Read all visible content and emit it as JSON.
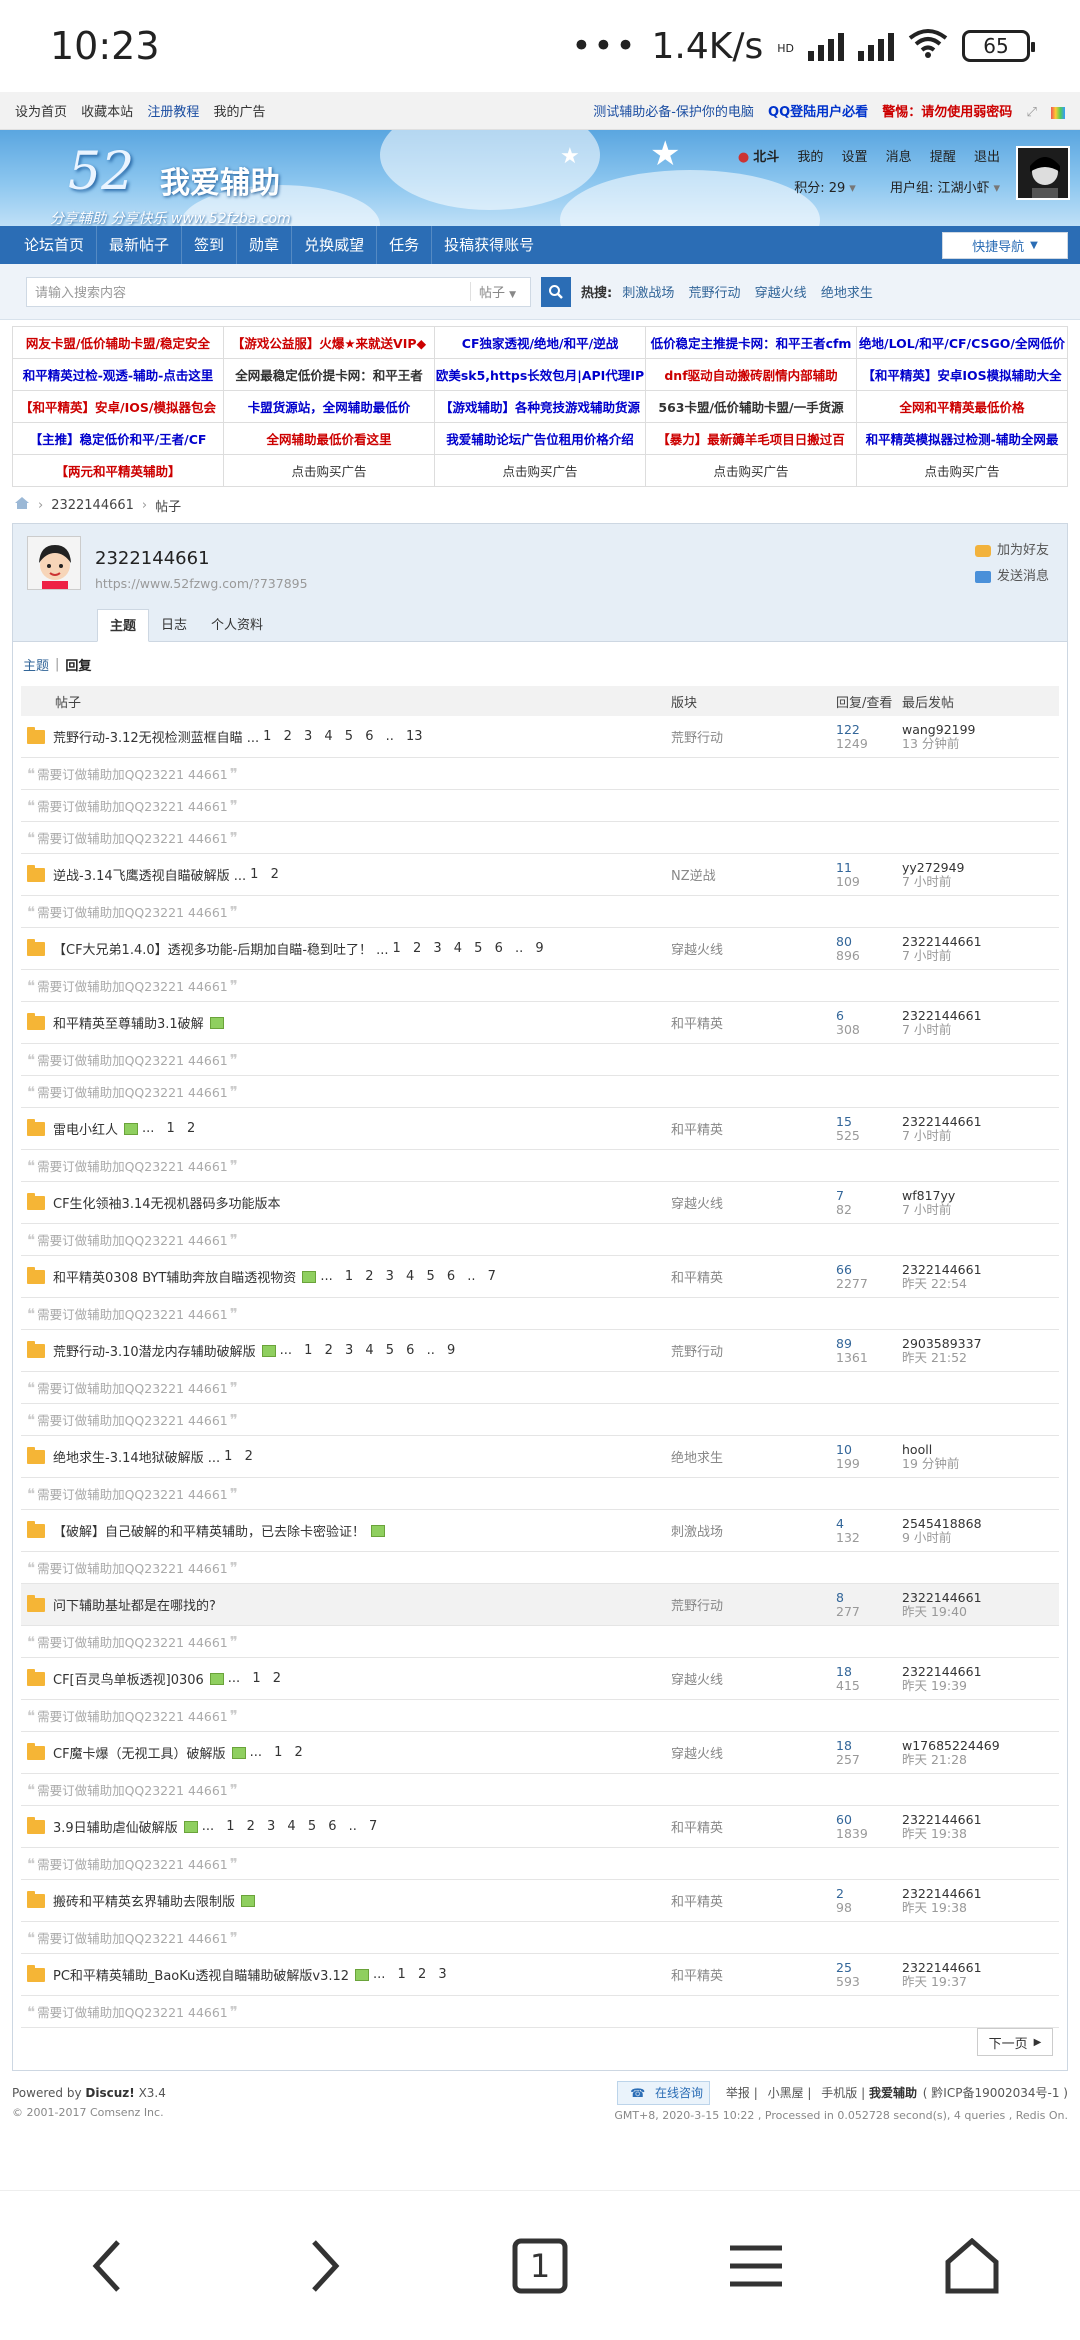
{
  "status_bar": {
    "time": "10:23",
    "dots": "•••",
    "speed": "1.4K/s",
    "hd": "HD",
    "battery": "65"
  },
  "top_links": {
    "left": [
      "设为首页",
      "收藏本站",
      "注册教程",
      "我的广告"
    ],
    "right1": "测试辅助必备-保护你的电脑",
    "right2": "QQ登陆用户必看",
    "right3": "警惕：请勿使用弱密码"
  },
  "logo": {
    "num": "52",
    "cn": "我爱辅助",
    "sub": "分享辅助 分享快乐 www.52fzba.com"
  },
  "user": {
    "name": "北斗",
    "links": [
      "我的",
      "设置",
      "消息",
      "提醒",
      "退出"
    ],
    "points": "积分: 29",
    "group": "用户组: 江湖小虾"
  },
  "nav": {
    "items": [
      "论坛首页",
      "最新帖子",
      "签到",
      "勋章",
      "兑换威望",
      "任务",
      "投稿获得账号"
    ],
    "quick": "快捷导航"
  },
  "search": {
    "placeholder": "请输入搜索内容",
    "type": "帖子",
    "hot_label": "热搜:",
    "hot": [
      "刺激战场",
      "荒野行动",
      "穿越火线",
      "绝地求生"
    ]
  },
  "ads": [
    [
      {
        "t": "网友卡盟/低价辅助卡盟/稳定安全",
        "c": "#cc0000"
      },
      {
        "t": "【游戏公益服】火爆★来就送VIP◆",
        "c": "#cc0000"
      },
      {
        "t": "CF独家透视/绝地/和平/逆战",
        "c": "#0000cc"
      },
      {
        "t": "低价稳定主推提卡网：和平王者cfm",
        "c": "#0000cc"
      },
      {
        "t": "绝地/LOL/和平/CF/CSGO/全网低价",
        "c": "#0000cc"
      }
    ],
    [
      {
        "t": "和平精英过检-观透-辅助-点击这里",
        "c": "#0000cc"
      },
      {
        "t": "全网最稳定低价提卡网：和平王者",
        "c": "#333333"
      },
      {
        "t": "欧美sk5,https长效包月|API代理IP",
        "c": "#0000cc"
      },
      {
        "t": "dnf驱动自动搬砖剧情内部辅助",
        "c": "#cc0000"
      },
      {
        "t": "【和平精英】安卓IOS模拟辅助大全",
        "c": "#0000cc"
      }
    ],
    [
      {
        "t": "【和平精英】安卓/IOS/模拟器包会",
        "c": "#cc0000"
      },
      {
        "t": "卡盟货源站，全网辅助最低价",
        "c": "#0000cc"
      },
      {
        "t": "【游戏辅助】各种竞技游戏辅助货源",
        "c": "#0000cc"
      },
      {
        "t": "563卡盟/低价辅助卡盟/一手货源",
        "c": "#333333"
      },
      {
        "t": "全网和平精英最低价格",
        "c": "#cc0000"
      }
    ],
    [
      {
        "t": "【主推】稳定低价和平/王者/CF",
        "c": "#0000cc"
      },
      {
        "t": "全网辅助最低价看这里",
        "c": "#cc0000"
      },
      {
        "t": "我爱辅助论坛广告位租用价格介绍",
        "c": "#0000cc"
      },
      {
        "t": "【暴力】最新薅羊毛项目日搬过百",
        "c": "#cc0000"
      },
      {
        "t": "和平精英模拟器过检测-辅助全网最",
        "c": "#0000cc"
      }
    ],
    [
      {
        "t": "【两元和平精英辅助】",
        "c": "#cc0000"
      },
      {
        "t": "点击购买广告",
        "c": "plain"
      },
      {
        "t": "点击购买广告",
        "c": "plain"
      },
      {
        "t": "点击购买广告",
        "c": "plain"
      },
      {
        "t": "点击购买广告",
        "c": "plain"
      }
    ]
  ],
  "breadcrumb": [
    "2322144661",
    "帖子"
  ],
  "profile": {
    "name": "2322144661",
    "url": "https://www.52fzwg.com/?737895",
    "add_friend": "加为好友",
    "send_msg": "发送消息",
    "tabs": [
      "主题",
      "日志",
      "个人资料"
    ]
  },
  "subtabs": {
    "a": "主题",
    "b": "回复"
  },
  "columns": {
    "title": "帖子",
    "forum": "版块",
    "rv": "回复/查看",
    "last": "最后发帖"
  },
  "note_text": "需要订做辅助加QQ23221 44661",
  "rows": [
    {
      "title": "荒野行动-3.12无视检测蓝框自瞄 ...",
      "pages": "1 2 3 4 5 6 .. 13",
      "att": false,
      "forum": "荒野行动",
      "r": "122",
      "v": "1249",
      "u": "wang92199",
      "t": "13 分钟前",
      "notes": 3,
      "hl": false
    },
    {
      "title": "逆战-3.14飞鹰透视自瞄破解版 ...",
      "pages": "1 2",
      "att": false,
      "forum": "NZ逆战",
      "r": "11",
      "v": "109",
      "u": "yy272949",
      "t": "7 小时前",
      "notes": 1,
      "hl": false
    },
    {
      "title": "【CF大兄弟1.4.0】透视多功能-后期加自瞄-稳到吐了！ ...",
      "pages": "1 2 3 4 5 6 .. 9",
      "att": false,
      "forum": "穿越火线",
      "r": "80",
      "v": "896",
      "u": "2322144661",
      "t": "7 小时前",
      "notes": 1,
      "hl": false
    },
    {
      "title": "和平精英至尊辅助3.1破解",
      "pages": "",
      "att": true,
      "forum": "和平精英",
      "r": "6",
      "v": "308",
      "u": "2322144661",
      "t": "7 小时前",
      "notes": 2,
      "hl": false
    },
    {
      "title": "雷电小红人",
      "pages": "... 1 2",
      "att": true,
      "forum": "和平精英",
      "r": "15",
      "v": "525",
      "u": "2322144661",
      "t": "7 小时前",
      "notes": 1,
      "hl": false
    },
    {
      "title": "CF生化领袖3.14无视机器码多功能版本",
      "pages": "",
      "att": false,
      "forum": "穿越火线",
      "r": "7",
      "v": "82",
      "u": "wf817yy",
      "t": "7 小时前",
      "notes": 1,
      "hl": false
    },
    {
      "title": "和平精英0308 BYT辅助奔放自瞄透视物资",
      "pages": "... 1 2 3 4 5 6 .. 7",
      "att": true,
      "forum": "和平精英",
      "r": "66",
      "v": "2277",
      "u": "2322144661",
      "t": "昨天 22:54",
      "notes": 1,
      "hl": false
    },
    {
      "title": "荒野行动-3.10潜龙内存辅助破解版",
      "pages": "... 1 2 3 4 5 6 .. 9",
      "att": true,
      "forum": "荒野行动",
      "r": "89",
      "v": "1361",
      "u": "2903589337",
      "t": "昨天 21:52",
      "notes": 2,
      "hl": false
    },
    {
      "title": "绝地求生-3.14地狱破解版 ...",
      "pages": "1 2",
      "att": false,
      "forum": "绝地求生",
      "r": "10",
      "v": "199",
      "u": "hooll",
      "t": "19 分钟前",
      "notes": 1,
      "hl": false
    },
    {
      "title": "【破解】自己破解的和平精英辅助，已去除卡密验证！",
      "pages": "",
      "att": true,
      "forum": "刺激战场",
      "r": "4",
      "v": "132",
      "u": "2545418868",
      "t": "9 小时前",
      "notes": 1,
      "hl": false
    },
    {
      "title": "问下辅助基址都是在哪找的?",
      "pages": "",
      "att": false,
      "forum": "荒野行动",
      "r": "8",
      "v": "277",
      "u": "2322144661",
      "t": "昨天 19:40",
      "notes": 1,
      "hl": true
    },
    {
      "title": "CF[百灵鸟单板透视]0306",
      "pages": "... 1 2",
      "att": true,
      "forum": "穿越火线",
      "r": "18",
      "v": "415",
      "u": "2322144661",
      "t": "昨天 19:39",
      "notes": 1,
      "hl": false
    },
    {
      "title": "CF魔卡爆（无视工具）破解版",
      "pages": "... 1 2",
      "att": true,
      "forum": "穿越火线",
      "r": "18",
      "v": "257",
      "u": "w17685224469",
      "t": "昨天 21:28",
      "notes": 1,
      "hl": false
    },
    {
      "title": "3.9日辅助虐仙破解版",
      "pages": "... 1 2 3 4 5 6 .. 7",
      "att": true,
      "forum": "和平精英",
      "r": "60",
      "v": "1839",
      "u": "2322144661",
      "t": "昨天 19:38",
      "notes": 1,
      "hl": false
    },
    {
      "title": "搬砖和平精英玄界辅助去限制版",
      "pages": "",
      "att": true,
      "forum": "和平精英",
      "r": "2",
      "v": "98",
      "u": "2322144661",
      "t": "昨天 19:38",
      "notes": 1,
      "hl": false
    },
    {
      "title": "PC和平精英辅助_BaoKu透视自瞄辅助破解版v3.12",
      "pages": "... 1 2 3",
      "att": true,
      "forum": "和平精英",
      "r": "25",
      "v": "593",
      "u": "2322144661",
      "t": "昨天 19:37",
      "notes": 1,
      "hl": false
    }
  ],
  "next_label": "下一页",
  "footer": {
    "powered_by": "Powered by",
    "powered_name": "Discuz!",
    "powered_ver": "X3.4",
    "copyright": "© 2001-2017 Comsenz Inc.",
    "zxzx": "在线咨询",
    "links": [
      "举报",
      "小黑屋",
      "手机版"
    ],
    "site": "我爱辅助",
    "icp": "( 黔ICP备19002034号-1 )",
    "gmt": "GMT+8, 2020-3-15 10:22 , Processed in 0.052728 second(s), 4 queries , Redis On."
  },
  "bottom_nav": {
    "tab_count": "1"
  }
}
